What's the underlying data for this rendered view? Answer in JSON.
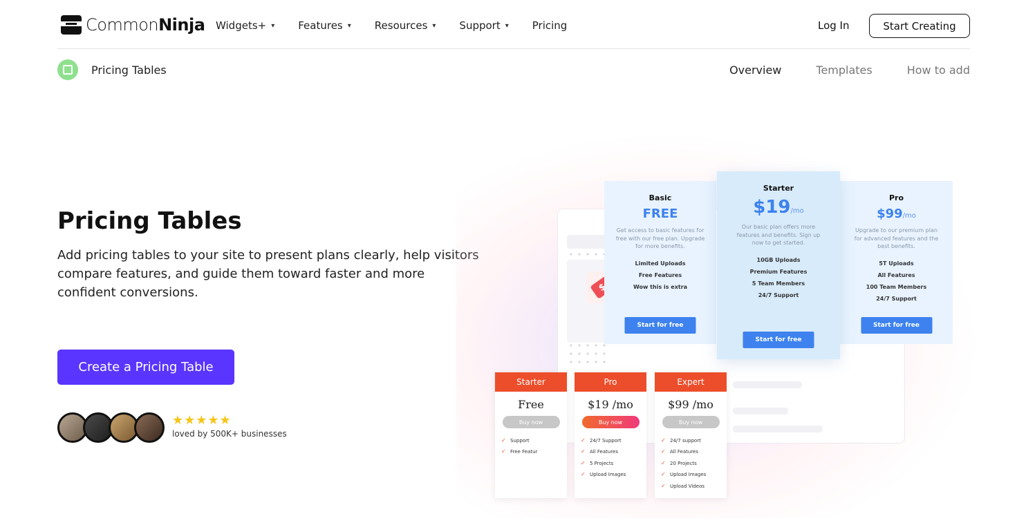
{
  "header": {
    "logo": {
      "light": "Common",
      "bold": "Ninja"
    },
    "nav": [
      {
        "label": "Widgets+",
        "chevron": true
      },
      {
        "label": "Features",
        "chevron": true
      },
      {
        "label": "Resources",
        "chevron": true
      },
      {
        "label": "Support",
        "chevron": true
      },
      {
        "label": "Pricing",
        "chevron": false
      }
    ],
    "login": "Log In",
    "start": "Start Creating"
  },
  "subheader": {
    "title": "Pricing Tables",
    "tabs": [
      {
        "label": "Overview",
        "active": true
      },
      {
        "label": "Templates",
        "active": false
      },
      {
        "label": "How to add",
        "active": false
      }
    ]
  },
  "hero": {
    "title": "Pricing Tables",
    "description": "Add pricing tables to your site to present plans clearly, help visitors compare features, and guide them toward faster and more confident conversions.",
    "cta": "Create a Pricing Table",
    "stars": "★★★★★",
    "loved": "loved by 500K+ businesses"
  },
  "illustration": {
    "tag_symbol": "$",
    "blue_cards": [
      {
        "name": "Basic",
        "price": "FREE",
        "per": "",
        "desc": "Get access to basic features for free with our free plan. Upgrade for more benefits.",
        "features": [
          "Limited Uploads",
          "Free Features",
          "Wow this is extra"
        ],
        "button": "Start for free"
      },
      {
        "name": "Starter",
        "price": "$19",
        "per": "/mo",
        "desc": "Our basic plan offers more features and benefits. Sign up now to get started.",
        "features": [
          "10GB Uploads",
          "Premium Features",
          "5 Team Members",
          "24/7 Support"
        ],
        "button": "Start for free"
      },
      {
        "name": "Pro",
        "price": "$99",
        "per": "/mo",
        "desc": "Upgrade to our premium plan for advanced features and the best benefits.",
        "features": [
          "5T Uploads",
          "All Features",
          "100 Team Members",
          "24/7 Support"
        ],
        "button": "Start for free"
      }
    ],
    "orange_cards": [
      {
        "name": "Starter",
        "price": "Free",
        "button": "Buy now",
        "features": [
          "Support",
          "Free Featur"
        ]
      },
      {
        "name": "Pro",
        "price": "$19 /mo",
        "button": "Buy now",
        "features": [
          "24/7 Support",
          "All Features",
          "5 Projects",
          "Upload Images"
        ]
      },
      {
        "name": "Expert",
        "price": "$99 /mo",
        "button": "Buy now",
        "features": [
          "24/7 support",
          "All Features",
          "20 Projects",
          "Upload Images",
          "Upload Videos"
        ]
      }
    ]
  },
  "colors": {
    "accent": "#5a35ff",
    "card_blue": "#3d82ee",
    "card_orange": "#ec4e2b",
    "star": "#f5c518"
  }
}
